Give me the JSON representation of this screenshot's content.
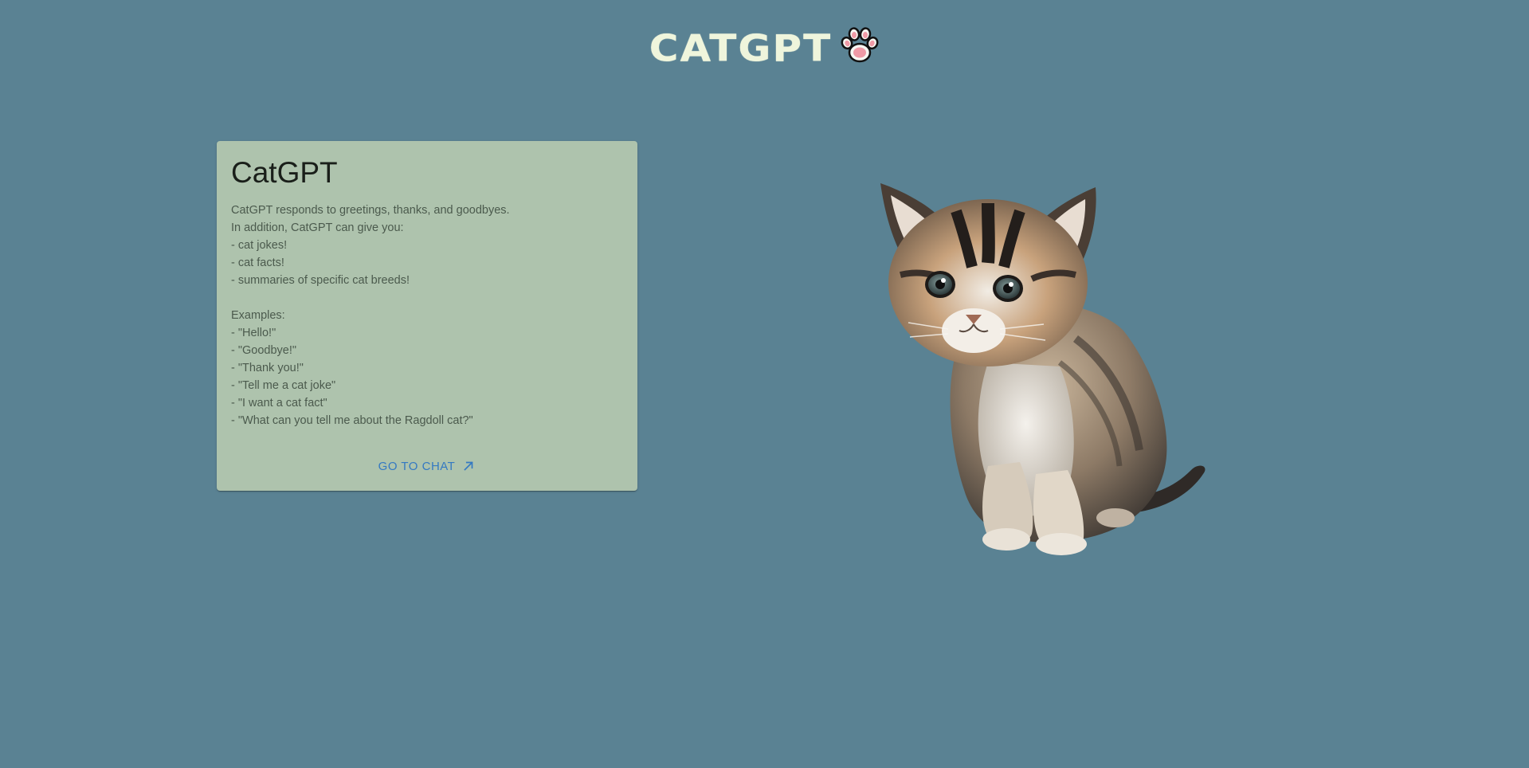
{
  "header": {
    "logo_text": "CATGPT",
    "logo_icon": "paw-icon"
  },
  "card": {
    "title": "CatGPT",
    "lines": [
      "CatGPT responds to greetings, thanks, and goodbyes.",
      "In addition, CatGPT can give you:",
      "- cat jokes!",
      "- cat facts!",
      "- summaries of specific cat breeds!",
      "",
      "Examples:",
      "- \"Hello!\"",
      "- \"Goodbye!\"",
      "- \"Thank you!\"",
      "- \"Tell me a cat joke\"",
      "- \"I want a cat fact\"",
      "- \"What can you tell me about the Ragdoll cat?\""
    ],
    "action_label": "GO TO CHAT",
    "action_icon": "arrow-up-right-icon"
  },
  "image": {
    "icon": "kitten-illustration"
  },
  "colors": {
    "background": "#5a8293",
    "card": "#aec3ad",
    "logo": "#eff5dc",
    "accent": "#3479c2",
    "paw": "#f09aa6"
  }
}
